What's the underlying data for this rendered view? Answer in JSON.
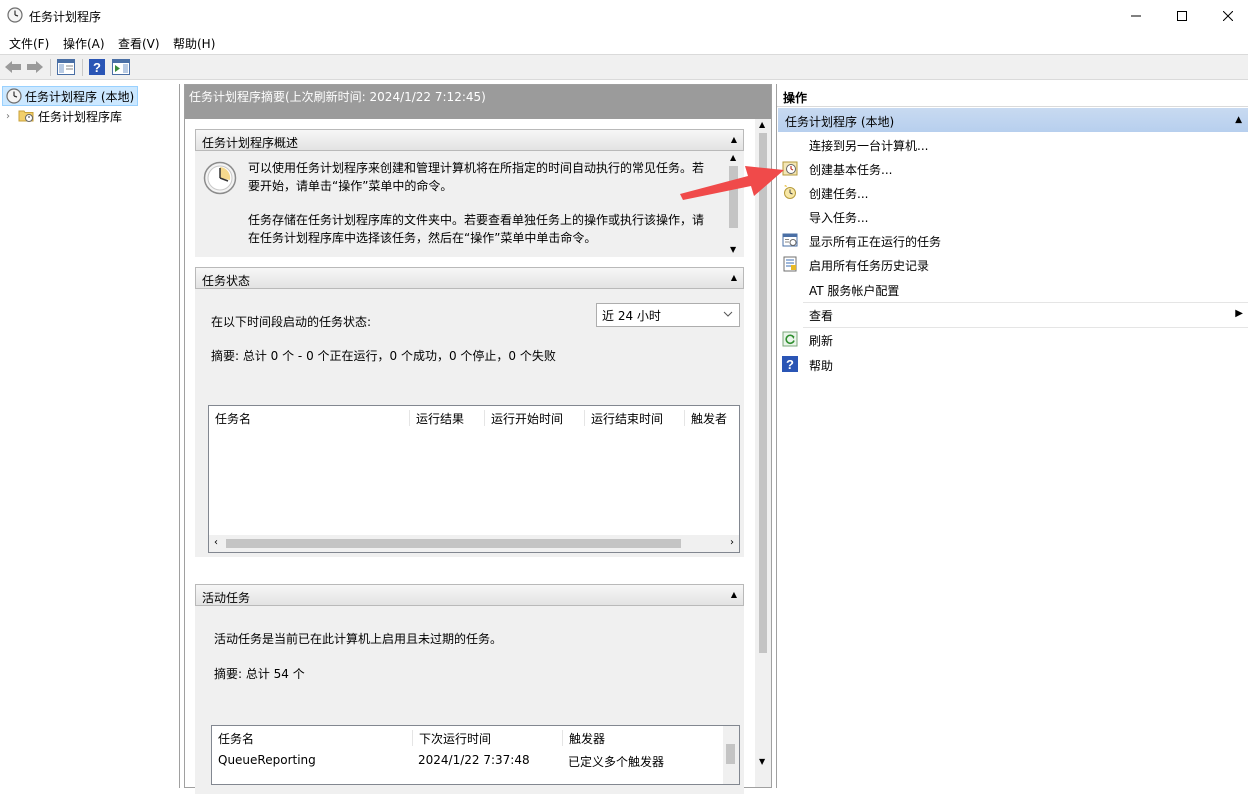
{
  "window": {
    "title": "任务计划程序",
    "icon": "clock-icon"
  },
  "menu": {
    "items": [
      {
        "label": "文件(F)"
      },
      {
        "label": "操作(A)"
      },
      {
        "label": "查看(V)"
      },
      {
        "label": "帮助(H)"
      }
    ]
  },
  "toolbar": {
    "buttons": [
      "back-icon",
      "forward-icon",
      "show-hide-console-tree-icon",
      "help-icon",
      "show-hide-action-pane-icon"
    ]
  },
  "tree": {
    "root_label": "任务计划程序 (本地)",
    "child_label": "任务计划程序库"
  },
  "center": {
    "header": "任务计划程序摘要(上次刷新时间: 2024/1/22 7:12:45)",
    "overview": {
      "title": "任务计划程序概述",
      "line1": "可以使用任务计划程序来创建和管理计算机将在所指定的时间自动执行的常见任务。若",
      "line2": "要开始，请单击“操作”菜单中的命令。",
      "line3": "任务存储在任务计划程序库的文件夹中。若要查看单独任务上的操作或执行该操作，请",
      "line4": "在任务计划程序库中选择该任务，然后在“操作”菜单中单击命令。"
    },
    "status": {
      "title": "任务状态",
      "period_label": "在以下时间段启动的任务状态:",
      "period_value": "近 24 小时",
      "summary": "摘要: 总计 0 个 - 0 个正在运行，0 个成功，0 个停止，0 个失败",
      "columns": [
        "任务名",
        "运行结果",
        "运行开始时间",
        "运行结束时间",
        "触发者"
      ]
    },
    "active": {
      "title": "活动任务",
      "description": "活动任务是当前已在此计算机上启用且未过期的任务。",
      "summary": "摘要: 总计 54 个",
      "columns": [
        "任务名",
        "下次运行时间",
        "触发器"
      ],
      "rows": [
        {
          "name": "QueueReporting",
          "next_run": "2024/1/22 7:37:48",
          "trigger": "已定义多个触发器"
        }
      ]
    }
  },
  "actions": {
    "title": "操作",
    "group": "任务计划程序 (本地)",
    "items": [
      {
        "label": "连接到另一台计算机...",
        "icon": ""
      },
      {
        "label": "创建基本任务...",
        "icon": "create-basic-task-icon"
      },
      {
        "label": "创建任务...",
        "icon": "create-task-icon"
      },
      {
        "label": "导入任务...",
        "icon": ""
      },
      {
        "label": "显示所有正在运行的任务",
        "icon": "running-tasks-icon"
      },
      {
        "label": "启用所有任务历史记录",
        "icon": "history-icon"
      },
      {
        "label": "AT 服务帐户配置",
        "icon": ""
      },
      {
        "label": "查看",
        "icon": ""
      },
      {
        "label": "刷新",
        "icon": "refresh-icon"
      },
      {
        "label": "帮助",
        "icon": "help-icon"
      }
    ]
  },
  "colors": {
    "annotation_arrow": "#f04a4a",
    "center_header_bg": "#9b9b9b",
    "actions_group_bg": "#bfd4ef",
    "tree_selected_bg": "#cce8ff"
  }
}
